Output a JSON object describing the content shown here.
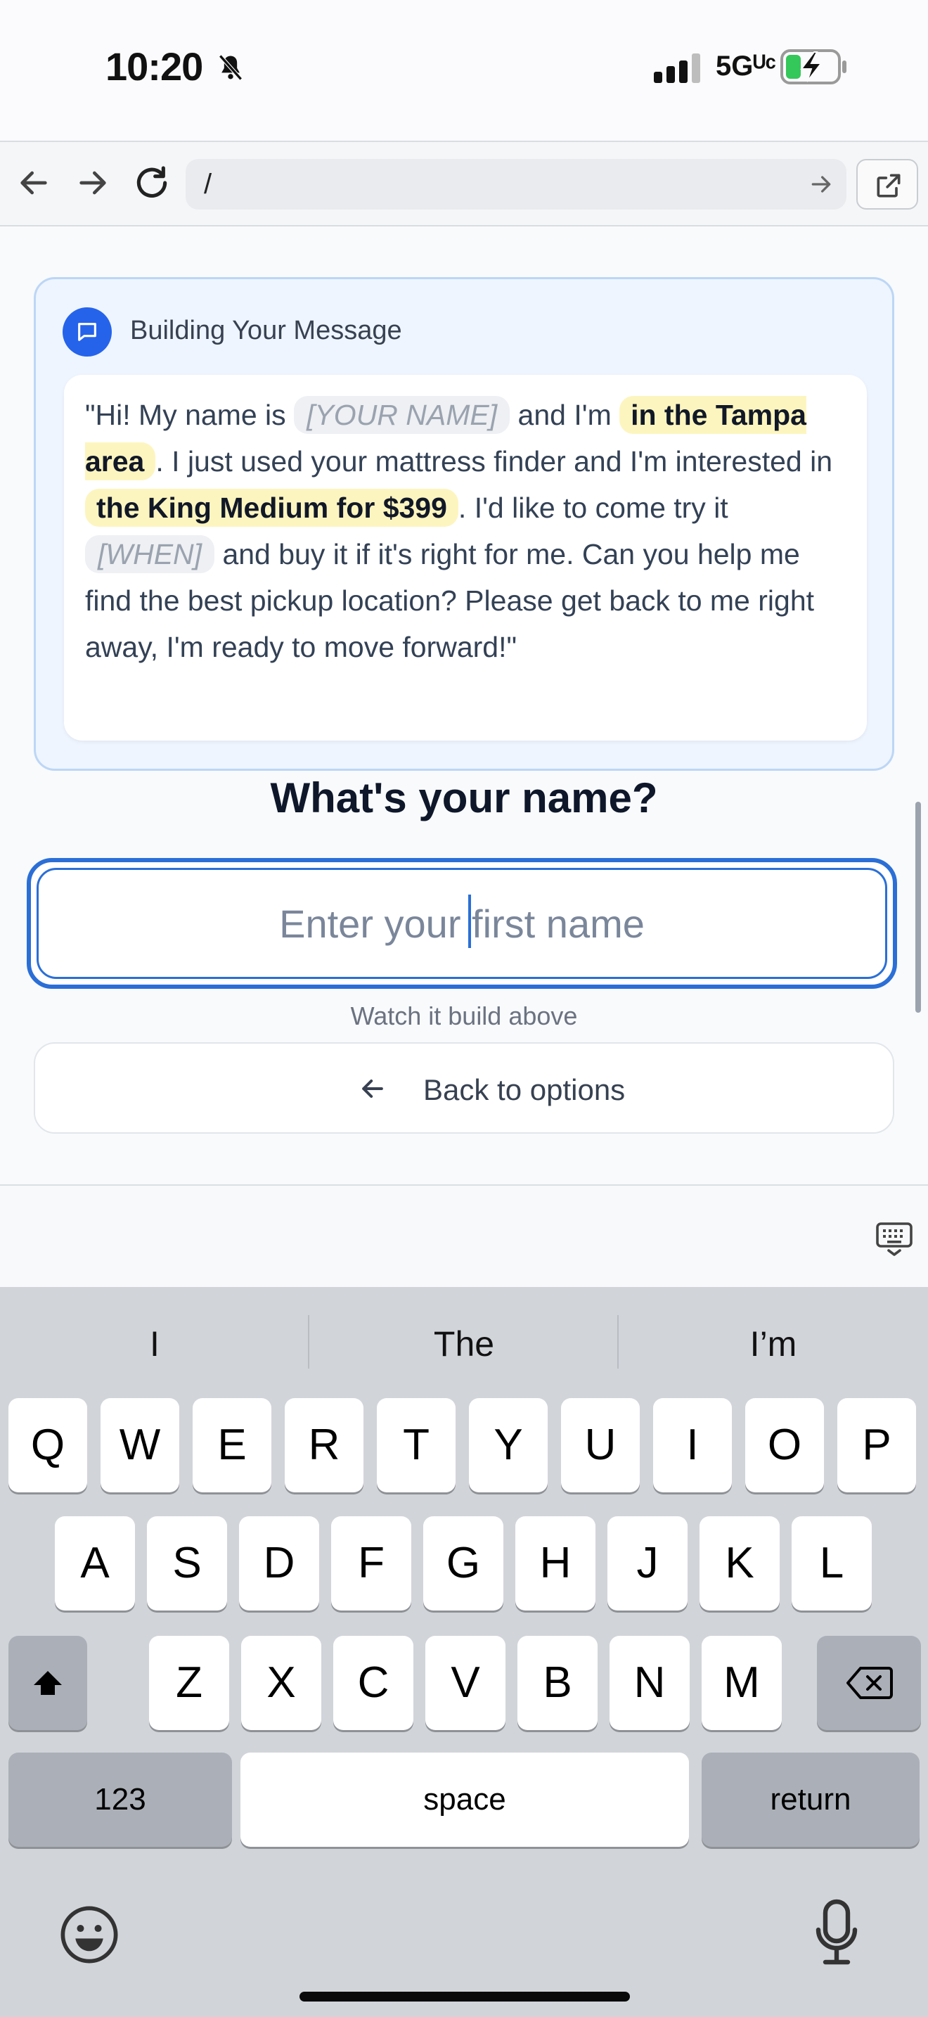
{
  "status_bar": {
    "time": "10:20",
    "network": "5Gᵁᶜ",
    "battery_level": 0.3
  },
  "browser": {
    "url": "/"
  },
  "card": {
    "title": "Building Your Message",
    "message": {
      "part1": "\"Hi! My name is ",
      "name_placeholder": "[YOUR NAME]",
      "part2": " and I'm ",
      "location": "in the Tampa area",
      "part3": ". I just used your mattress finder and I'm interested in ",
      "product": "the King Medium for $399",
      "part4": ". I'd like to come try it ",
      "when_placeholder": "[WHEN]",
      "part5": " and buy it if it's right for me. Can you help me find the best pickup location? Please get back to me right away, I'm ready to move forward!\""
    }
  },
  "form": {
    "question": "What's your name?",
    "name_placeholder": "Enter your first name",
    "name_value": "",
    "hint": "Watch it build above",
    "back_label": "Back to options"
  },
  "keyboard": {
    "suggestions": [
      "I",
      "The",
      "I’m"
    ],
    "row1": [
      "Q",
      "W",
      "E",
      "R",
      "T",
      "Y",
      "U",
      "I",
      "O",
      "P"
    ],
    "row2": [
      "A",
      "S",
      "D",
      "F",
      "G",
      "H",
      "J",
      "K",
      "L"
    ],
    "row3": [
      "Z",
      "X",
      "C",
      "V",
      "B",
      "N",
      "M"
    ],
    "numbers_label": "123",
    "space_label": "space",
    "return_label": "return"
  },
  "colors": {
    "accent": "#2563eb",
    "highlight": "#fdf5bf",
    "card_bg": "#eef5ff"
  }
}
